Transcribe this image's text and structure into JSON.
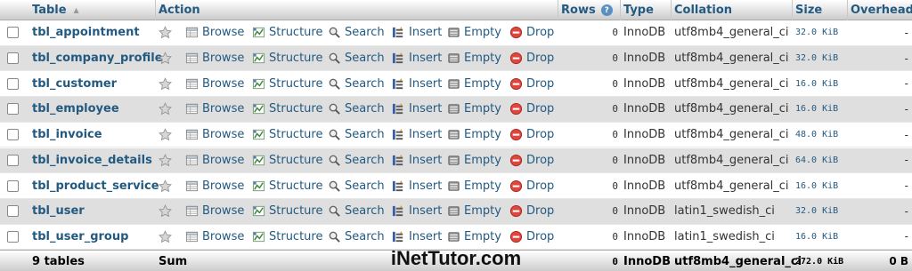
{
  "header": {
    "table": "Table",
    "action": "Action",
    "rows": "Rows",
    "type": "Type",
    "collation": "Collation",
    "size": "Size",
    "overhead": "Overhead"
  },
  "actions": {
    "browse": "Browse",
    "structure": "Structure",
    "search": "Search",
    "insert": "Insert",
    "empty": "Empty",
    "drop": "Drop"
  },
  "rows": [
    {
      "name": "tbl_appointment",
      "rows": "0",
      "type": "InnoDB",
      "collation": "utf8mb4_general_ci",
      "size": "32.0 KiB",
      "overhead": "-"
    },
    {
      "name": "tbl_company_profile",
      "rows": "0",
      "type": "InnoDB",
      "collation": "utf8mb4_general_ci",
      "size": "32.0 KiB",
      "overhead": "-"
    },
    {
      "name": "tbl_customer",
      "rows": "0",
      "type": "InnoDB",
      "collation": "utf8mb4_general_ci",
      "size": "16.0 KiB",
      "overhead": "-"
    },
    {
      "name": "tbl_employee",
      "rows": "0",
      "type": "InnoDB",
      "collation": "utf8mb4_general_ci",
      "size": "16.0 KiB",
      "overhead": "-"
    },
    {
      "name": "tbl_invoice",
      "rows": "0",
      "type": "InnoDB",
      "collation": "utf8mb4_general_ci",
      "size": "48.0 KiB",
      "overhead": "-"
    },
    {
      "name": "tbl_invoice_details",
      "rows": "0",
      "type": "InnoDB",
      "collation": "utf8mb4_general_ci",
      "size": "64.0 KiB",
      "overhead": "-"
    },
    {
      "name": "tbl_product_service",
      "rows": "0",
      "type": "InnoDB",
      "collation": "utf8mb4_general_ci",
      "size": "16.0 KiB",
      "overhead": "-"
    },
    {
      "name": "tbl_user",
      "rows": "0",
      "type": "InnoDB",
      "collation": "latin1_swedish_ci",
      "size": "32.0 KiB",
      "overhead": "-"
    },
    {
      "name": "tbl_user_group",
      "rows": "0",
      "type": "InnoDB",
      "collation": "latin1_swedish_ci",
      "size": "16.0 KiB",
      "overhead": "-"
    }
  ],
  "footer": {
    "count": "9 tables",
    "sum": "Sum",
    "rows": "0",
    "type": "InnoDB",
    "collation": "utf8mb4_general_ci",
    "size": "272.0 KiB",
    "overhead": "0 B"
  },
  "watermark": "iNetTutor.com",
  "colors": {
    "link": "#235a81",
    "row_alt": "#dfdfdf",
    "drop": "#d9302b"
  },
  "icons": {
    "favorite": "star-icon",
    "browse": "browse-icon",
    "structure": "structure-icon",
    "search": "search-icon",
    "insert": "insert-icon",
    "empty": "empty-icon",
    "drop": "drop-icon",
    "help": "help-icon",
    "sort": "sort-arrow-icon"
  }
}
